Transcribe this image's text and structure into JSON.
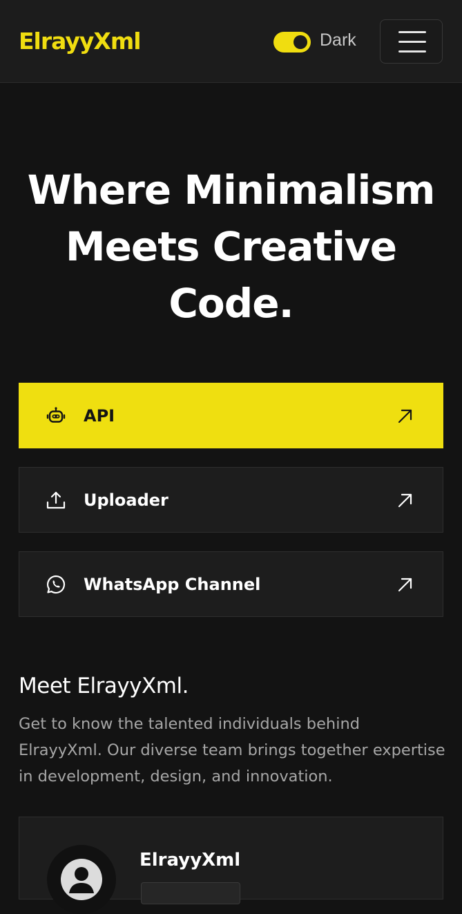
{
  "header": {
    "logo": "ElrayyXml",
    "theme_label": "Dark",
    "theme_on": true
  },
  "hero": {
    "title_lines": [
      "Where Minimalism",
      "Meets Creative",
      "Code."
    ]
  },
  "links": [
    {
      "label": "API",
      "icon": "robot-icon",
      "active": true
    },
    {
      "label": "Uploader",
      "icon": "upload-icon",
      "active": false
    },
    {
      "label": "WhatsApp Channel",
      "icon": "whatsapp-icon",
      "active": false
    }
  ],
  "team": {
    "heading": "Meet ElrayyXml.",
    "description": "Get to know the talented individuals behind ElrayyXml. Our diverse team brings together expertise in development, design, and innovation.",
    "members": [
      {
        "name": "ElrayyXml",
        "avatar_icon": "user-avatar-icon"
      }
    ]
  },
  "colors": {
    "accent": "#efdf10",
    "background": "#131313",
    "surface": "#1d1d1d"
  }
}
